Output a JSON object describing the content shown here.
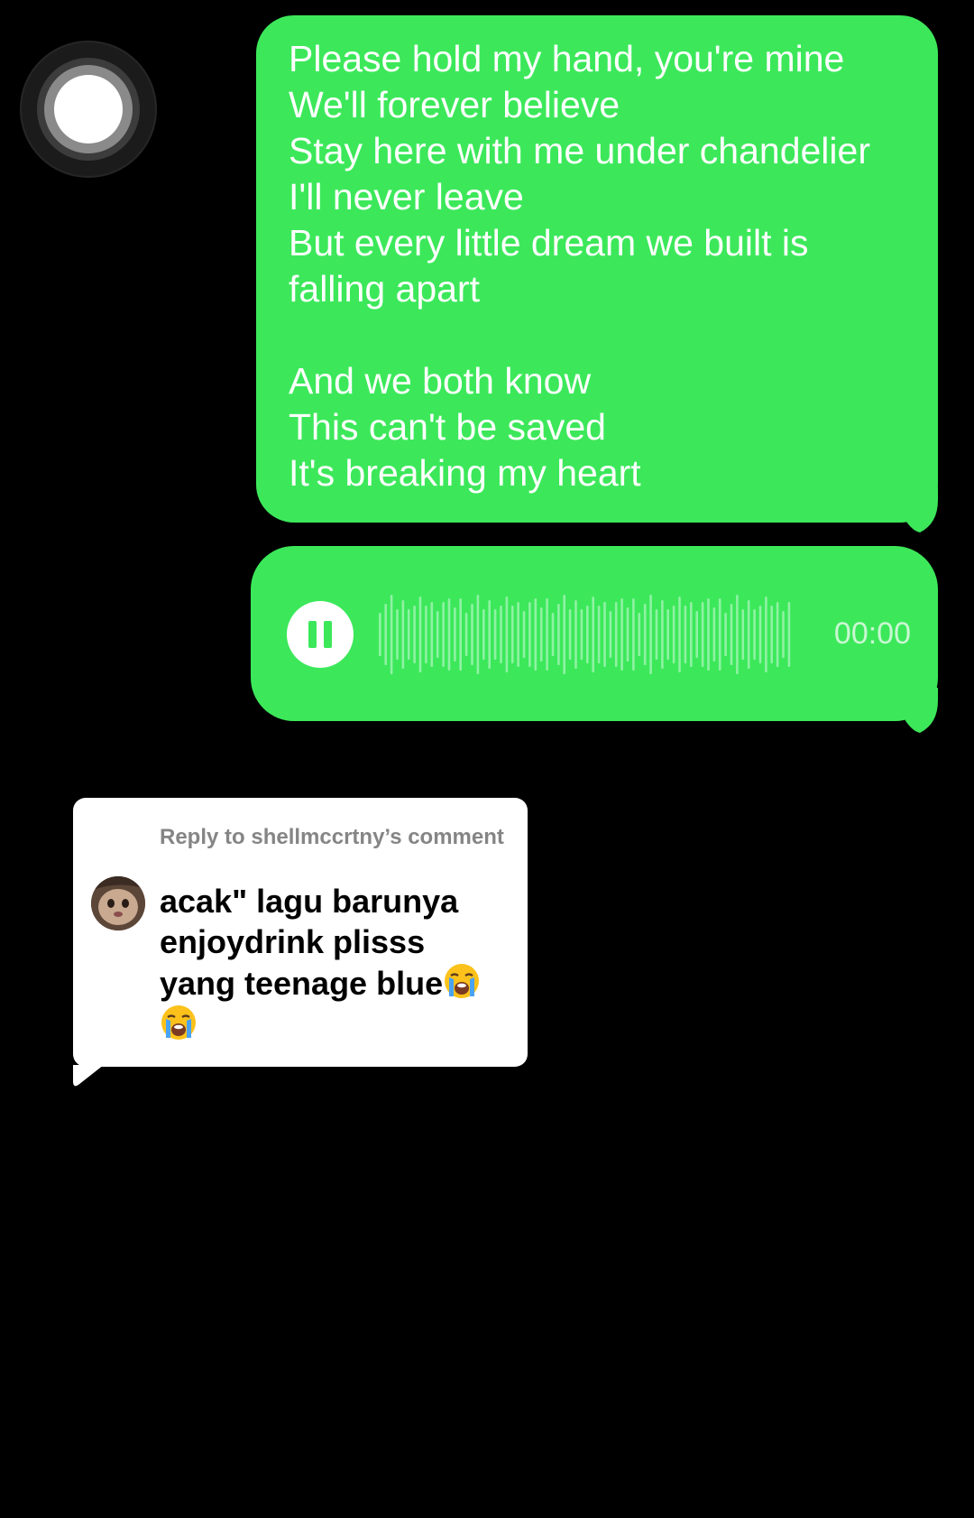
{
  "lyrics_message": {
    "lines": [
      "Please hold my hand, you're mine",
      "We'll forever believe",
      "Stay here with me under chandelier",
      "I'll never leave",
      "But every little dream we built is",
      "falling apart",
      "",
      "And we both know",
      "This can't be saved",
      "It's breaking my heart"
    ]
  },
  "voice_message": {
    "timer": "00:00",
    "state_icon": "pause-icon"
  },
  "reply_comment": {
    "header": "Reply to shellmccrtny’s comment",
    "lines": [
      "acak\" lagu barunya",
      "enjoydrink plisss",
      "yang teenage blue"
    ],
    "emoji_name": "loudly-crying-face-emoji"
  },
  "colors": {
    "background": "#000000",
    "bubble_green": "#3ce85a",
    "card_white": "#ffffff",
    "header_gray": "#858585"
  }
}
